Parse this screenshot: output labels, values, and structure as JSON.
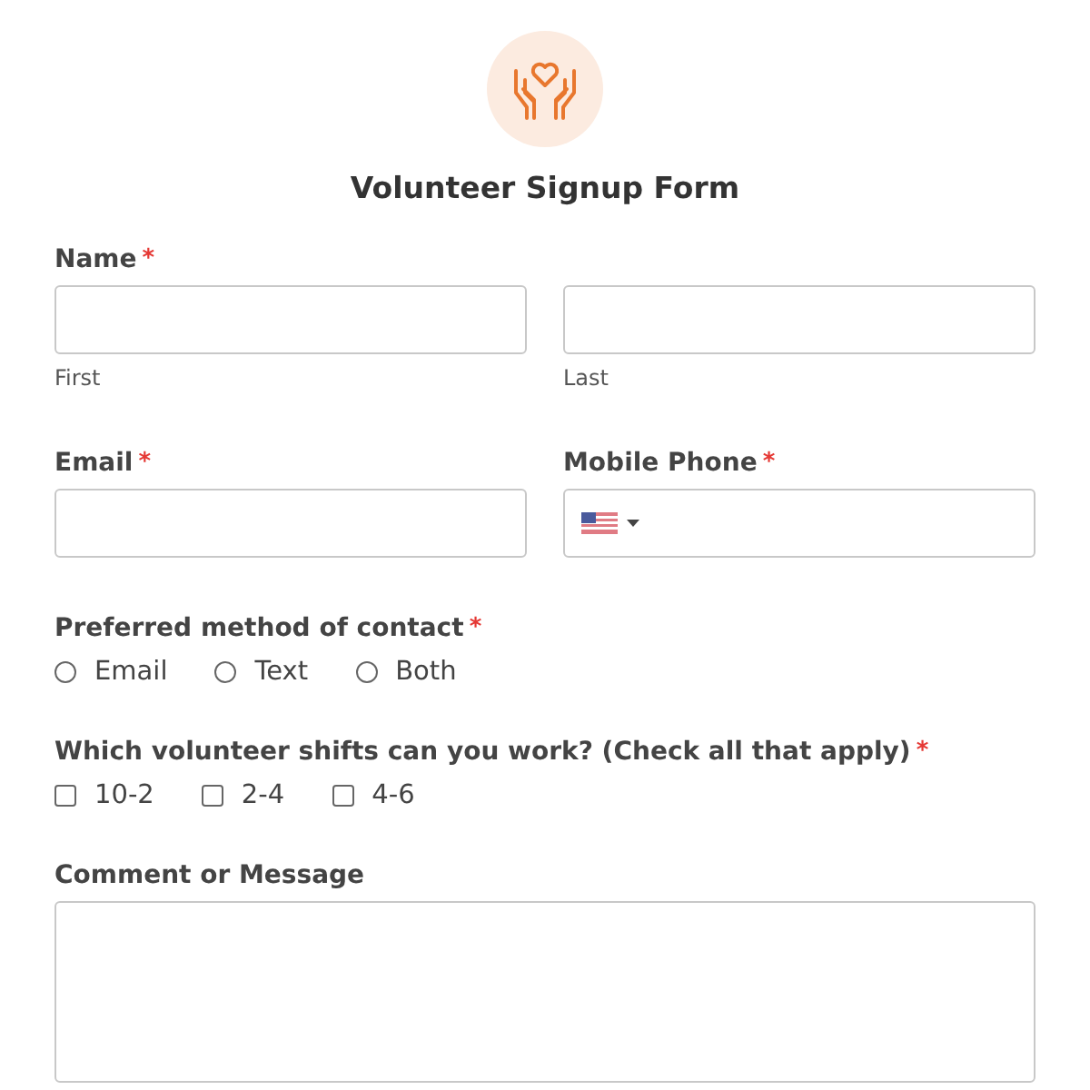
{
  "form": {
    "title": "Volunteer Signup Form"
  },
  "name": {
    "label": "Name",
    "required_mark": "*",
    "parts": [
      {
        "sublabel": "First"
      },
      {
        "sublabel": "Last"
      }
    ]
  },
  "email": {
    "label": "Email",
    "required_mark": "*"
  },
  "phone": {
    "label": "Mobile Phone",
    "required_mark": "*"
  },
  "contact": {
    "label": "Preferred method of contact",
    "required_mark": "*",
    "options": [
      {
        "label": "Email",
        "selected": false
      },
      {
        "label": "Text",
        "selected": false
      },
      {
        "label": "Both",
        "selected": false
      }
    ]
  },
  "shifts": {
    "label": "Which volunteer shifts can you work? (Check all that apply)",
    "required_mark": "*",
    "options": [
      {
        "label": "10-2",
        "checked": false
      },
      {
        "label": "2-4",
        "checked": false
      },
      {
        "label": "4-6",
        "checked": false
      }
    ]
  },
  "comment": {
    "label": "Comment or Message"
  }
}
